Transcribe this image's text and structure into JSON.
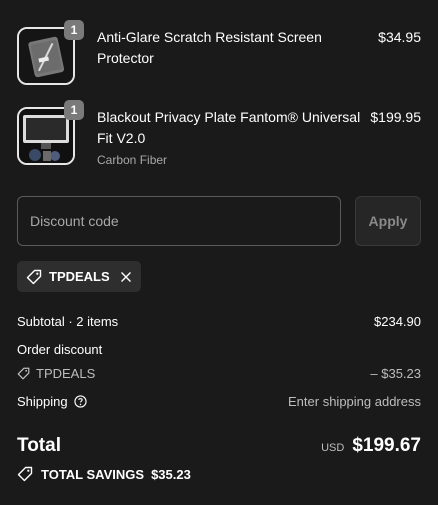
{
  "cart": {
    "items": [
      {
        "quantity": "1",
        "title": "Anti-Glare Scratch Resistant Screen Protector",
        "variant": "",
        "price": "$34.95"
      },
      {
        "quantity": "1",
        "title": "Blackout Privacy Plate Fantom® Universal Fit V2.0",
        "variant": "Carbon Fiber",
        "price": "$199.95"
      }
    ]
  },
  "discount": {
    "placeholder": "Discount code",
    "apply_label": "Apply",
    "applied_code": "TPDEALS"
  },
  "summary": {
    "subtotal_label": "Subtotal · 2 items",
    "subtotal_value": "$234.90",
    "order_discount_label": "Order discount",
    "discount_code": "TPDEALS",
    "discount_value": "– $35.23",
    "shipping_label": "Shipping",
    "shipping_value": "Enter shipping address",
    "total_label": "Total",
    "currency": "USD",
    "total_value": "$199.67",
    "savings_label": "TOTAL SAVINGS",
    "savings_value": "$35.23"
  },
  "icons": {
    "tag": "tag-icon",
    "close": "close-icon",
    "help": "help-circle-icon"
  },
  "colors": {
    "background": "#1a1a1a",
    "text": "#ffffff",
    "muted": "#bdbdbd",
    "badge": "#7a7a7a",
    "chip": "#2e2e2e"
  }
}
